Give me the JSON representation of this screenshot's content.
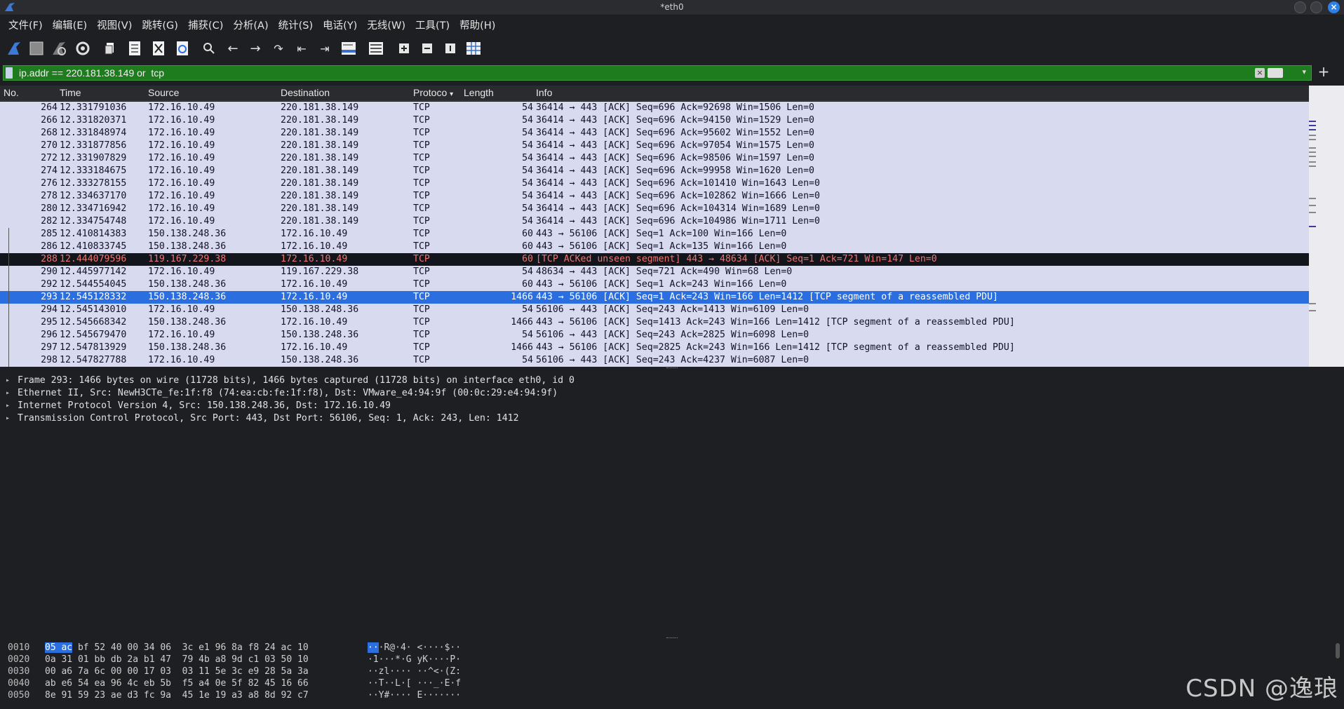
{
  "window": {
    "title": "*eth0"
  },
  "menu": [
    "文件(F)",
    "编辑(E)",
    "视图(V)",
    "跳转(G)",
    "捕获(C)",
    "分析(A)",
    "统计(S)",
    "电话(Y)",
    "无线(W)",
    "工具(T)",
    "帮助(H)"
  ],
  "toolbar": {
    "icons": [
      "shark-fin-start-icon",
      "stop-square-icon",
      "restart-capture-icon",
      "capture-options-gear-icon",
      "open-file-icon",
      "save-file-icon",
      "close-file-icon",
      "reload-file-icon",
      "find-packet-icon",
      "go-back-icon",
      "go-forward-icon",
      "go-to-packet-icon",
      "go-first-icon",
      "go-last-icon",
      "auto-scroll-icon",
      "colorize-icon",
      "zoom-in-icon",
      "zoom-out-icon",
      "normal-size-icon",
      "resize-columns-icon"
    ]
  },
  "filter": {
    "value": "ip.addr == 220.181.38.149 or  tcp",
    "add_label": "+"
  },
  "columns": {
    "no": "No.",
    "time": "Time",
    "source": "Source",
    "destination": "Destination",
    "protocol": "Protoco",
    "length": "Length",
    "info": "Info"
  },
  "packets": [
    {
      "no": "264",
      "time": "12.331791036",
      "src": "172.16.10.49",
      "dst": "220.181.38.149",
      "proto": "TCP",
      "len": "54",
      "info": "36414 → 443 [ACK] Seq=696 Ack=92698 Win=1506 Len=0"
    },
    {
      "no": "266",
      "time": "12.331820371",
      "src": "172.16.10.49",
      "dst": "220.181.38.149",
      "proto": "TCP",
      "len": "54",
      "info": "36414 → 443 [ACK] Seq=696 Ack=94150 Win=1529 Len=0"
    },
    {
      "no": "268",
      "time": "12.331848974",
      "src": "172.16.10.49",
      "dst": "220.181.38.149",
      "proto": "TCP",
      "len": "54",
      "info": "36414 → 443 [ACK] Seq=696 Ack=95602 Win=1552 Len=0"
    },
    {
      "no": "270",
      "time": "12.331877856",
      "src": "172.16.10.49",
      "dst": "220.181.38.149",
      "proto": "TCP",
      "len": "54",
      "info": "36414 → 443 [ACK] Seq=696 Ack=97054 Win=1575 Len=0"
    },
    {
      "no": "272",
      "time": "12.331907829",
      "src": "172.16.10.49",
      "dst": "220.181.38.149",
      "proto": "TCP",
      "len": "54",
      "info": "36414 → 443 [ACK] Seq=696 Ack=98506 Win=1597 Len=0"
    },
    {
      "no": "274",
      "time": "12.333184675",
      "src": "172.16.10.49",
      "dst": "220.181.38.149",
      "proto": "TCP",
      "len": "54",
      "info": "36414 → 443 [ACK] Seq=696 Ack=99958 Win=1620 Len=0"
    },
    {
      "no": "276",
      "time": "12.333278155",
      "src": "172.16.10.49",
      "dst": "220.181.38.149",
      "proto": "TCP",
      "len": "54",
      "info": "36414 → 443 [ACK] Seq=696 Ack=101410 Win=1643 Len=0"
    },
    {
      "no": "278",
      "time": "12.334637170",
      "src": "172.16.10.49",
      "dst": "220.181.38.149",
      "proto": "TCP",
      "len": "54",
      "info": "36414 → 443 [ACK] Seq=696 Ack=102862 Win=1666 Len=0"
    },
    {
      "no": "280",
      "time": "12.334716942",
      "src": "172.16.10.49",
      "dst": "220.181.38.149",
      "proto": "TCP",
      "len": "54",
      "info": "36414 → 443 [ACK] Seq=696 Ack=104314 Win=1689 Len=0"
    },
    {
      "no": "282",
      "time": "12.334754748",
      "src": "172.16.10.49",
      "dst": "220.181.38.149",
      "proto": "TCP",
      "len": "54",
      "info": "36414 → 443 [ACK] Seq=696 Ack=104986 Win=1711 Len=0"
    },
    {
      "no": "285",
      "time": "12.410814383",
      "src": "150.138.248.36",
      "dst": "172.16.10.49",
      "proto": "TCP",
      "len": "60",
      "info": "443 → 56106 [ACK] Seq=1 Ack=100 Win=166 Len=0"
    },
    {
      "no": "286",
      "time": "12.410833745",
      "src": "150.138.248.36",
      "dst": "172.16.10.49",
      "proto": "TCP",
      "len": "60",
      "info": "443 → 56106 [ACK] Seq=1 Ack=135 Win=166 Len=0"
    },
    {
      "no": "288",
      "time": "12.444079596",
      "src": "119.167.229.38",
      "dst": "172.16.10.49",
      "proto": "TCP",
      "len": "60",
      "info": "[TCP ACKed unseen segment] 443 → 48634 [ACK] Seq=1 Ack=721 Win=147 Len=0",
      "state": "err"
    },
    {
      "no": "290",
      "time": "12.445977142",
      "src": "172.16.10.49",
      "dst": "119.167.229.38",
      "proto": "TCP",
      "len": "54",
      "info": "48634 → 443 [ACK] Seq=721 Ack=490 Win=68 Len=0"
    },
    {
      "no": "292",
      "time": "12.544554045",
      "src": "150.138.248.36",
      "dst": "172.16.10.49",
      "proto": "TCP",
      "len": "60",
      "info": "443 → 56106 [ACK] Seq=1 Ack=243 Win=166 Len=0"
    },
    {
      "no": "293",
      "time": "12.545128332",
      "src": "150.138.248.36",
      "dst": "172.16.10.49",
      "proto": "TCP",
      "len": "1466",
      "info": "443 → 56106 [ACK] Seq=1 Ack=243 Win=166 Len=1412 [TCP segment of a reassembled PDU]",
      "state": "sel"
    },
    {
      "no": "294",
      "time": "12.545143010",
      "src": "172.16.10.49",
      "dst": "150.138.248.36",
      "proto": "TCP",
      "len": "54",
      "info": "56106 → 443 [ACK] Seq=243 Ack=1413 Win=6109 Len=0"
    },
    {
      "no": "295",
      "time": "12.545668342",
      "src": "150.138.248.36",
      "dst": "172.16.10.49",
      "proto": "TCP",
      "len": "1466",
      "info": "443 → 56106 [ACK] Seq=1413 Ack=243 Win=166 Len=1412 [TCP segment of a reassembled PDU]"
    },
    {
      "no": "296",
      "time": "12.545679470",
      "src": "172.16.10.49",
      "dst": "150.138.248.36",
      "proto": "TCP",
      "len": "54",
      "info": "56106 → 443 [ACK] Seq=243 Ack=2825 Win=6098 Len=0"
    },
    {
      "no": "297",
      "time": "12.547813929",
      "src": "150.138.248.36",
      "dst": "172.16.10.49",
      "proto": "TCP",
      "len": "1466",
      "info": "443 → 56106 [ACK] Seq=2825 Ack=243 Win=166 Len=1412 [TCP segment of a reassembled PDU]"
    },
    {
      "no": "298",
      "time": "12.547827788",
      "src": "172.16.10.49",
      "dst": "150.138.248.36",
      "proto": "TCP",
      "len": "54",
      "info": "56106 → 443 [ACK] Seq=243 Ack=4237 Win=6087 Len=0"
    }
  ],
  "details": [
    "Frame 293: 1466 bytes on wire (11728 bits), 1466 bytes captured (11728 bits) on interface eth0, id 0",
    "Ethernet II, Src: NewH3CTe_fe:1f:f8 (74:ea:cb:fe:1f:f8), Dst: VMware_e4:94:9f (00:0c:29:e4:94:9f)",
    "Internet Protocol Version 4, Src: 150.138.248.36, Dst: 172.16.10.49",
    "Transmission Control Protocol, Src Port: 443, Dst Port: 56106, Seq: 1, Ack: 243, Len: 1412"
  ],
  "bytes": [
    {
      "off": "0010",
      "hl": "05 ac",
      "hex": " bf 52 40 00 34 06  3c e1 96 8a f8 24 ac 10",
      "ahl": "··",
      "asc": "·R@·4· <····$··"
    },
    {
      "off": "0020",
      "hl": "",
      "hex": "0a 31 01 bb db 2a b1 47  79 4b a8 9d c1 03 50 10",
      "ahl": "",
      "asc": "·1···*·G yK····P·"
    },
    {
      "off": "0030",
      "hl": "",
      "hex": "00 a6 7a 6c 00 00 17 03  03 11 5e 3c e9 28 5a 3a",
      "ahl": "",
      "asc": "··zl···· ··^<·(Z:"
    },
    {
      "off": "0040",
      "hl": "",
      "hex": "ab e6 54 ea 96 4c eb 5b  f5 a4 0e 5f 82 45 16 66",
      "ahl": "",
      "asc": "··T··L·[ ···_·E·f"
    },
    {
      "off": "0050",
      "hl": "",
      "hex": "8e 91 59 23 ae d3 fc 9a  45 1e 19 a3 a8 8d 92 c7",
      "ahl": "",
      "asc": "··Y#···· E·······"
    }
  ],
  "watermark": "CSDN @逸琅",
  "colors": {
    "selected": "#2a6ee0",
    "error_bg": "#12161c",
    "error_fg": "#f0746e",
    "row_bg": "#d8daf0",
    "filter_valid": "#1e7b1e"
  }
}
